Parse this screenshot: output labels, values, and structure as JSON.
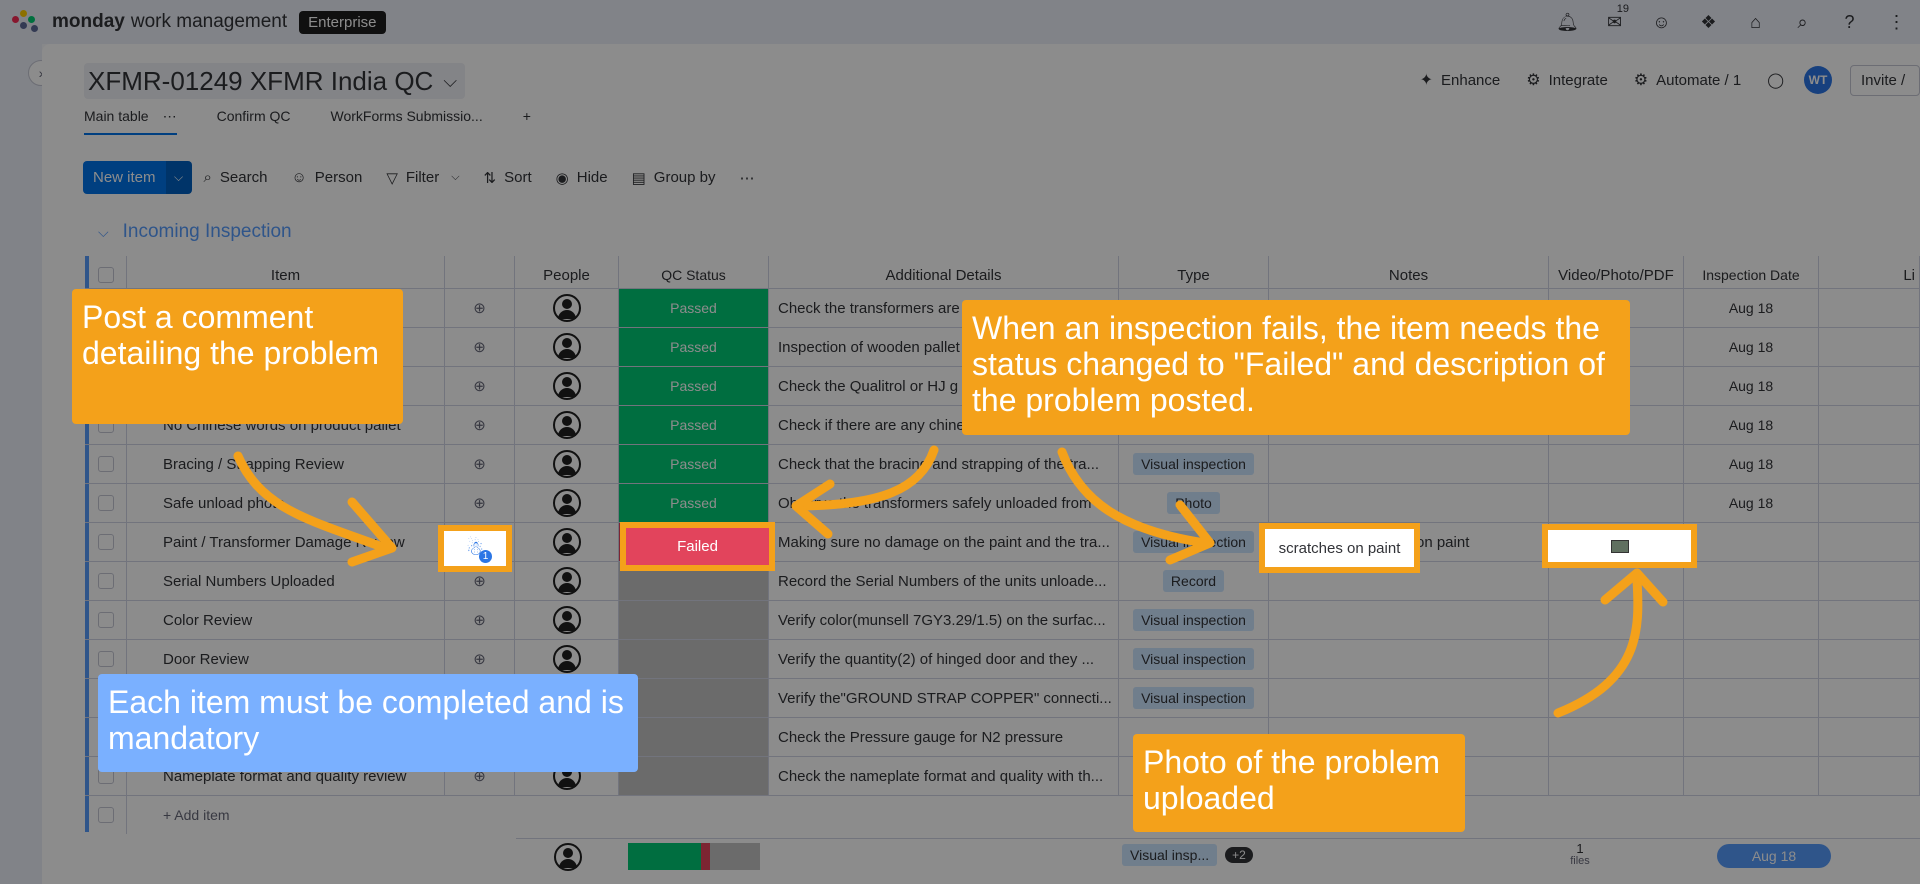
{
  "topbar": {
    "brand_bold": "monday",
    "brand_light": "work management",
    "plan_badge": "Enterprise",
    "inbox_count": "19"
  },
  "board": {
    "title": "XFMR-01249 XFMR India QC",
    "header_actions": {
      "enhance": "Enhance",
      "integrate": "Integrate",
      "automate": "Automate / 1",
      "avatar_initials": "WT",
      "invite": "Invite /"
    },
    "tabs": [
      "Main table",
      "Confirm QC",
      "WorkForms Submissio..."
    ],
    "tab_more": "⋯",
    "add_tab": "+"
  },
  "toolbar": {
    "new_item": "New item",
    "search": "Search",
    "person": "Person",
    "filter": "Filter",
    "sort": "Sort",
    "hide": "Hide",
    "group_by": "Group by",
    "more": "⋯"
  },
  "group": {
    "title": "Incoming Inspection"
  },
  "columns": {
    "item": "Item",
    "people": "People",
    "qc_status": "QC Status",
    "details": "Additional Details",
    "type": "Type",
    "notes": "Notes",
    "media": "Video/Photo/PDF",
    "date": "Inspection Date",
    "last": "Li"
  },
  "rows": [
    {
      "item": "",
      "status": "Passed",
      "status_kind": "pass",
      "details": "Check the transformers are",
      "type": "",
      "notes": "",
      "date": "Aug 18"
    },
    {
      "item": "",
      "status": "Passed",
      "status_kind": "pass",
      "details": "Inspection of wooden pallet",
      "type": "",
      "notes": "",
      "date": "Aug 18"
    },
    {
      "item": "",
      "status": "Passed",
      "status_kind": "pass",
      "details": "Check the Qualitrol or HJ g",
      "type": "",
      "notes": "",
      "date": "Aug 18"
    },
    {
      "item": "No Chinese words on product pallet",
      "status": "Passed",
      "status_kind": "pass",
      "details": "Check if there are any chine",
      "type": "",
      "notes": "",
      "date": "Aug 18"
    },
    {
      "item": "Bracing / Strapping Review",
      "status": "Passed",
      "status_kind": "pass",
      "details": "Check that the bracing and strapping of the tra...",
      "type": "Visual inspection",
      "notes": "",
      "date": "Aug 18"
    },
    {
      "item": "Safe unload photo",
      "status": "Passed",
      "status_kind": "pass",
      "details": "Observe the transformers safely unloaded from",
      "type": "Photo",
      "notes": "",
      "date": "Aug 18"
    },
    {
      "item": "Paint / Transformer Damage Review",
      "status": "Failed",
      "status_kind": "fail",
      "details": "Making sure no damage on the paint and the tra...",
      "type": "Visual inspection",
      "notes": "scratches on paint",
      "date": ""
    },
    {
      "item": "Serial Numbers Uploaded",
      "status": "",
      "status_kind": "empty",
      "details": "Record the Serial Numbers of the units unloade...",
      "type": "Record",
      "notes": "",
      "date": ""
    },
    {
      "item": "Color Review",
      "status": "",
      "status_kind": "empty",
      "details": "Verify color(munsell 7GY3.29/1.5) on the surfac...",
      "type": "Visual inspection",
      "notes": "",
      "date": ""
    },
    {
      "item": "Door Review",
      "status": "",
      "status_kind": "empty",
      "details": "Verify the quantity(2) of hinged door and they ...",
      "type": "Visual inspection",
      "notes": "",
      "date": ""
    },
    {
      "item": "",
      "status": "",
      "status_kind": "empty",
      "details": "Verify the\"GROUND STRAP COPPER\" connecti...",
      "type": "Visual inspection",
      "notes": "",
      "date": ""
    },
    {
      "item": "",
      "status": "",
      "status_kind": "empty",
      "details": "Check the Pressure gauge for N2 pressure",
      "type": "",
      "notes": "",
      "date": ""
    },
    {
      "item": "Nameplate format and quality review",
      "status": "",
      "status_kind": "empty",
      "details": "Check the nameplate format and quality with th...",
      "type": "",
      "notes": "",
      "date": ""
    }
  ],
  "add_item": "+ Add item",
  "summary": {
    "type_chip": "Visual insp...",
    "type_more": "+2",
    "files_count": "1",
    "files_label": "files",
    "date": "Aug 18",
    "status_fractions": {
      "passed": 0.55,
      "failed": 0.07,
      "empty": 0.38
    }
  },
  "callouts": {
    "comment": "Post a comment detailing the problem",
    "status": "When an inspection fails, the item needs the status changed to \"Failed\" and description of the problem posted.",
    "mandatory": "Each item must be completed and is mandatory",
    "photo": "Photo of the problem uploaded"
  },
  "update_badge_count": "1",
  "colors": {
    "accent": "#0073ea",
    "passed": "#00c875",
    "failed": "#e2445c",
    "callout_orange": "#f4a11a",
    "callout_blue": "#7ab0ff"
  },
  "icons": [
    "bell-icon",
    "inbox-icon",
    "invite-icon",
    "apps-icon",
    "integrations-icon",
    "search-icon",
    "help-icon",
    "menu-icon"
  ]
}
